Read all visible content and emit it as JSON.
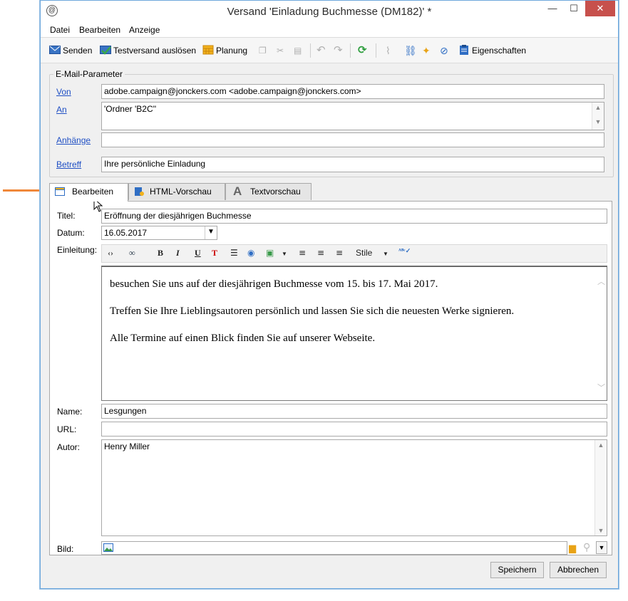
{
  "window": {
    "title": "Versand 'Einladung Buchmesse (DM182)' *",
    "minimize_glyph": "—",
    "maximize_glyph": "☐",
    "close_glyph": "✕"
  },
  "menu": [
    "Datei",
    "Bearbeiten",
    "Anzeige"
  ],
  "toolbar": {
    "send": "Senden",
    "test_send": "Testversand auslösen",
    "planning": "Planung",
    "properties": "Eigenschaften"
  },
  "email_params": {
    "legend": "E-Mail-Parameter",
    "from_label": "Von",
    "from_value": "adobe.campaign@jonckers.com <adobe.campaign@jonckers.com>",
    "to_label": "An",
    "to_value": "'Ordner 'B2C''",
    "attachments_label": "Anhänge",
    "attachments_value": "",
    "subject_label": "Betreff",
    "subject_value": "Ihre persönliche Einladung"
  },
  "tabs": [
    "Bearbeiten",
    "HTML-Vorschau",
    "Textvorschau"
  ],
  "form": {
    "title_label": "Titel:",
    "title_value": "Eröffnung der diesjährigen Buchmesse",
    "date_label": "Datum:",
    "date_value": "16.05.2017",
    "intro_label": "Einleitung:",
    "style_select": "Stile",
    "intro_paragraphs": [
      "besuchen Sie uns auf der diesjährigen Buchmesse vom 15. bis 17. Mai 2017.",
      "Treffen Sie Ihre Lieblingsautoren persönlich und lassen Sie sich die neuesten Werke signieren.",
      "Alle Termine auf einen Blick finden Sie auf unserer Webseite."
    ],
    "name_label": "Name:",
    "name_value": "Lesgungen",
    "url_label": "URL:",
    "url_value": "",
    "author_label": "Autor:",
    "author_value": "Henry Miller",
    "image_label": "Bild:",
    "image_value": ""
  },
  "buttons": {
    "save": "Speichern",
    "cancel": "Abbrechen"
  },
  "colors": {
    "accent_arrow": "#f0883a",
    "link": "#1f4fc4",
    "close_button": "#c7504c"
  }
}
